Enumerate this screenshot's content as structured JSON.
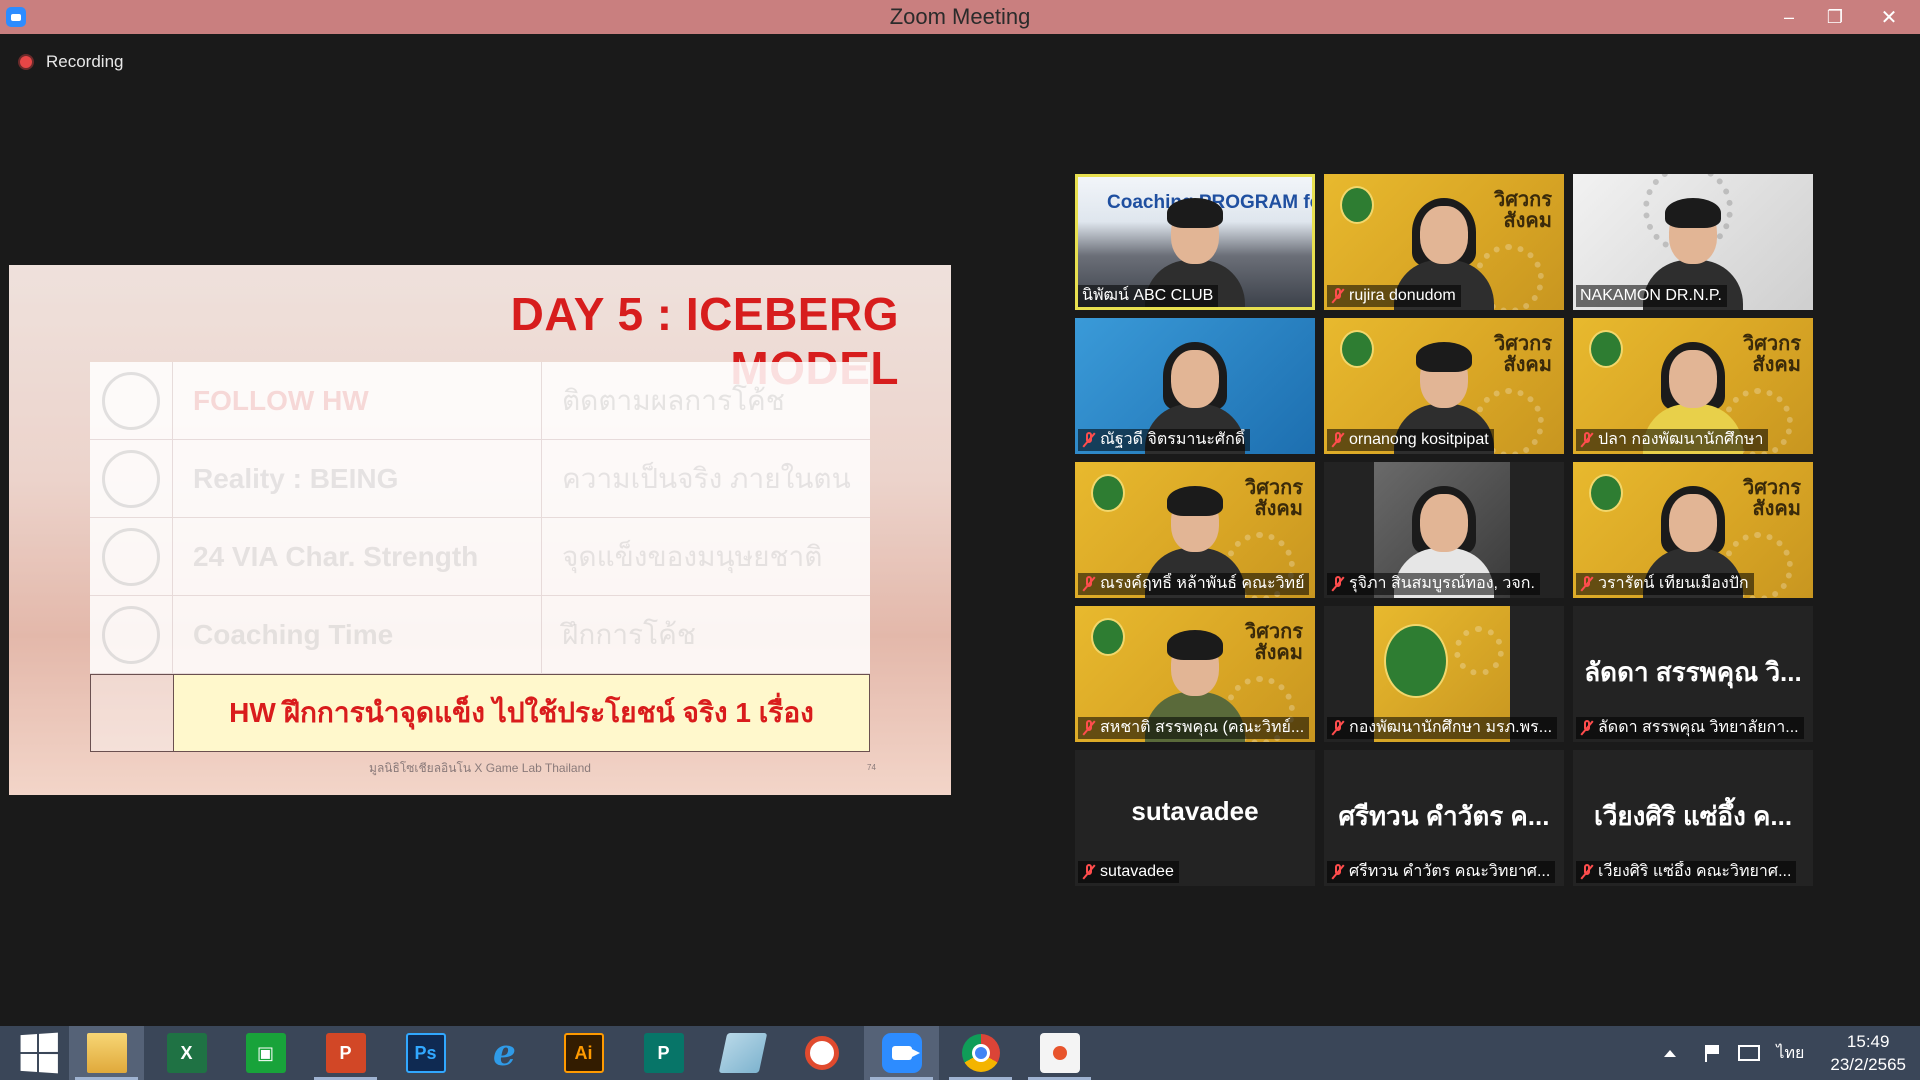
{
  "window": {
    "title": "Zoom Meeting",
    "minimize": "–",
    "restore": "❐",
    "close": "✕"
  },
  "recording": {
    "label": "Recording"
  },
  "slide": {
    "title": "DAY 5 : ICEBERG MODEL",
    "rows": [
      {
        "en": "FOLLOW HW",
        "th": "ติดตามผลการโค้ช"
      },
      {
        "en": "Reality : BEING",
        "th": "ความเป็นจริง ภายในตน"
      },
      {
        "en": "24 VIA Char. Strength",
        "th": "จุดแข็งของมนุษยชาติ"
      },
      {
        "en": "Coaching Time",
        "th": "ฝึกการโค้ช"
      }
    ],
    "highlight": "HW ฝึกการนำจุดแข็ง ไปใช้ประโยชน์ จริง 1 เรื่อง",
    "footer": "มูลนิธิโซเชียลอินโน X Game Lab Thailand",
    "page": "74"
  },
  "gallery": {
    "brand_text": "วิศวกร สังคม",
    "coaching_banner": "Coaching PROGRAM for Lecturer",
    "participants": [
      {
        "name": "นิพัฒน์ ABC CLUB",
        "muted": false,
        "active": true
      },
      {
        "name": "rujira donudom",
        "muted": true
      },
      {
        "name": "NAKAMON DR.N.P.",
        "muted": false
      },
      {
        "name": "ณัฐวดี จิตรมานะศักดิ์",
        "muted": true
      },
      {
        "name": "ornanong kositpipat",
        "muted": true
      },
      {
        "name": "ปลา กองพัฒนานักศึกษา",
        "muted": true
      },
      {
        "name": "ณรงค์ฤทธิ์ หล้าพันธ์ คณะวิทย์",
        "muted": true
      },
      {
        "name": "รุจิภา สินสมบูรณ์ทอง, วจก.",
        "muted": true
      },
      {
        "name": "วรารัตน์ เทียนเมืองปัก",
        "muted": true
      },
      {
        "name": "สหชาติ สรรพคุณ (คณะวิทย์...",
        "muted": true
      },
      {
        "name": "กองพัฒนานักศึกษา มรภ.พร...",
        "muted": true
      },
      {
        "name": "ลัดดา สรรพคุณ วิทยาลัยกา...",
        "muted": true,
        "display": "ลัดดา สรรพคุณ วิ..."
      },
      {
        "name": "sutavadee",
        "muted": true,
        "display": "sutavadee"
      },
      {
        "name": "ศรีทวน คำวัตร คณะวิทยาศ...",
        "muted": true,
        "display": "ศรีทวน คำวัตร ค..."
      },
      {
        "name": "เวียงศิริ แซ่อึ้ง คณะวิทยาศ...",
        "muted": true,
        "display": "เวียงศิริ แซ่อึ้ง ค..."
      }
    ]
  },
  "taskbar": {
    "apps": [
      {
        "name": "File Explorer",
        "glyph": ""
      },
      {
        "name": "Excel",
        "glyph": "X"
      },
      {
        "name": "Store",
        "glyph": "▣"
      },
      {
        "name": "PowerPoint",
        "glyph": "P"
      },
      {
        "name": "Photoshop",
        "glyph": "Ps"
      },
      {
        "name": "Internet Explorer",
        "glyph": "e"
      },
      {
        "name": "Illustrator",
        "glyph": "Ai"
      },
      {
        "name": "Publisher",
        "glyph": "P"
      },
      {
        "name": "Notes",
        "glyph": ""
      },
      {
        "name": "PhotoScape",
        "glyph": ""
      },
      {
        "name": "Zoom",
        "glyph": ""
      },
      {
        "name": "Chrome",
        "glyph": ""
      },
      {
        "name": "Pinpoint",
        "glyph": ""
      }
    ],
    "language": "ไทย",
    "time": "15:49",
    "date": "23/2/2565"
  }
}
